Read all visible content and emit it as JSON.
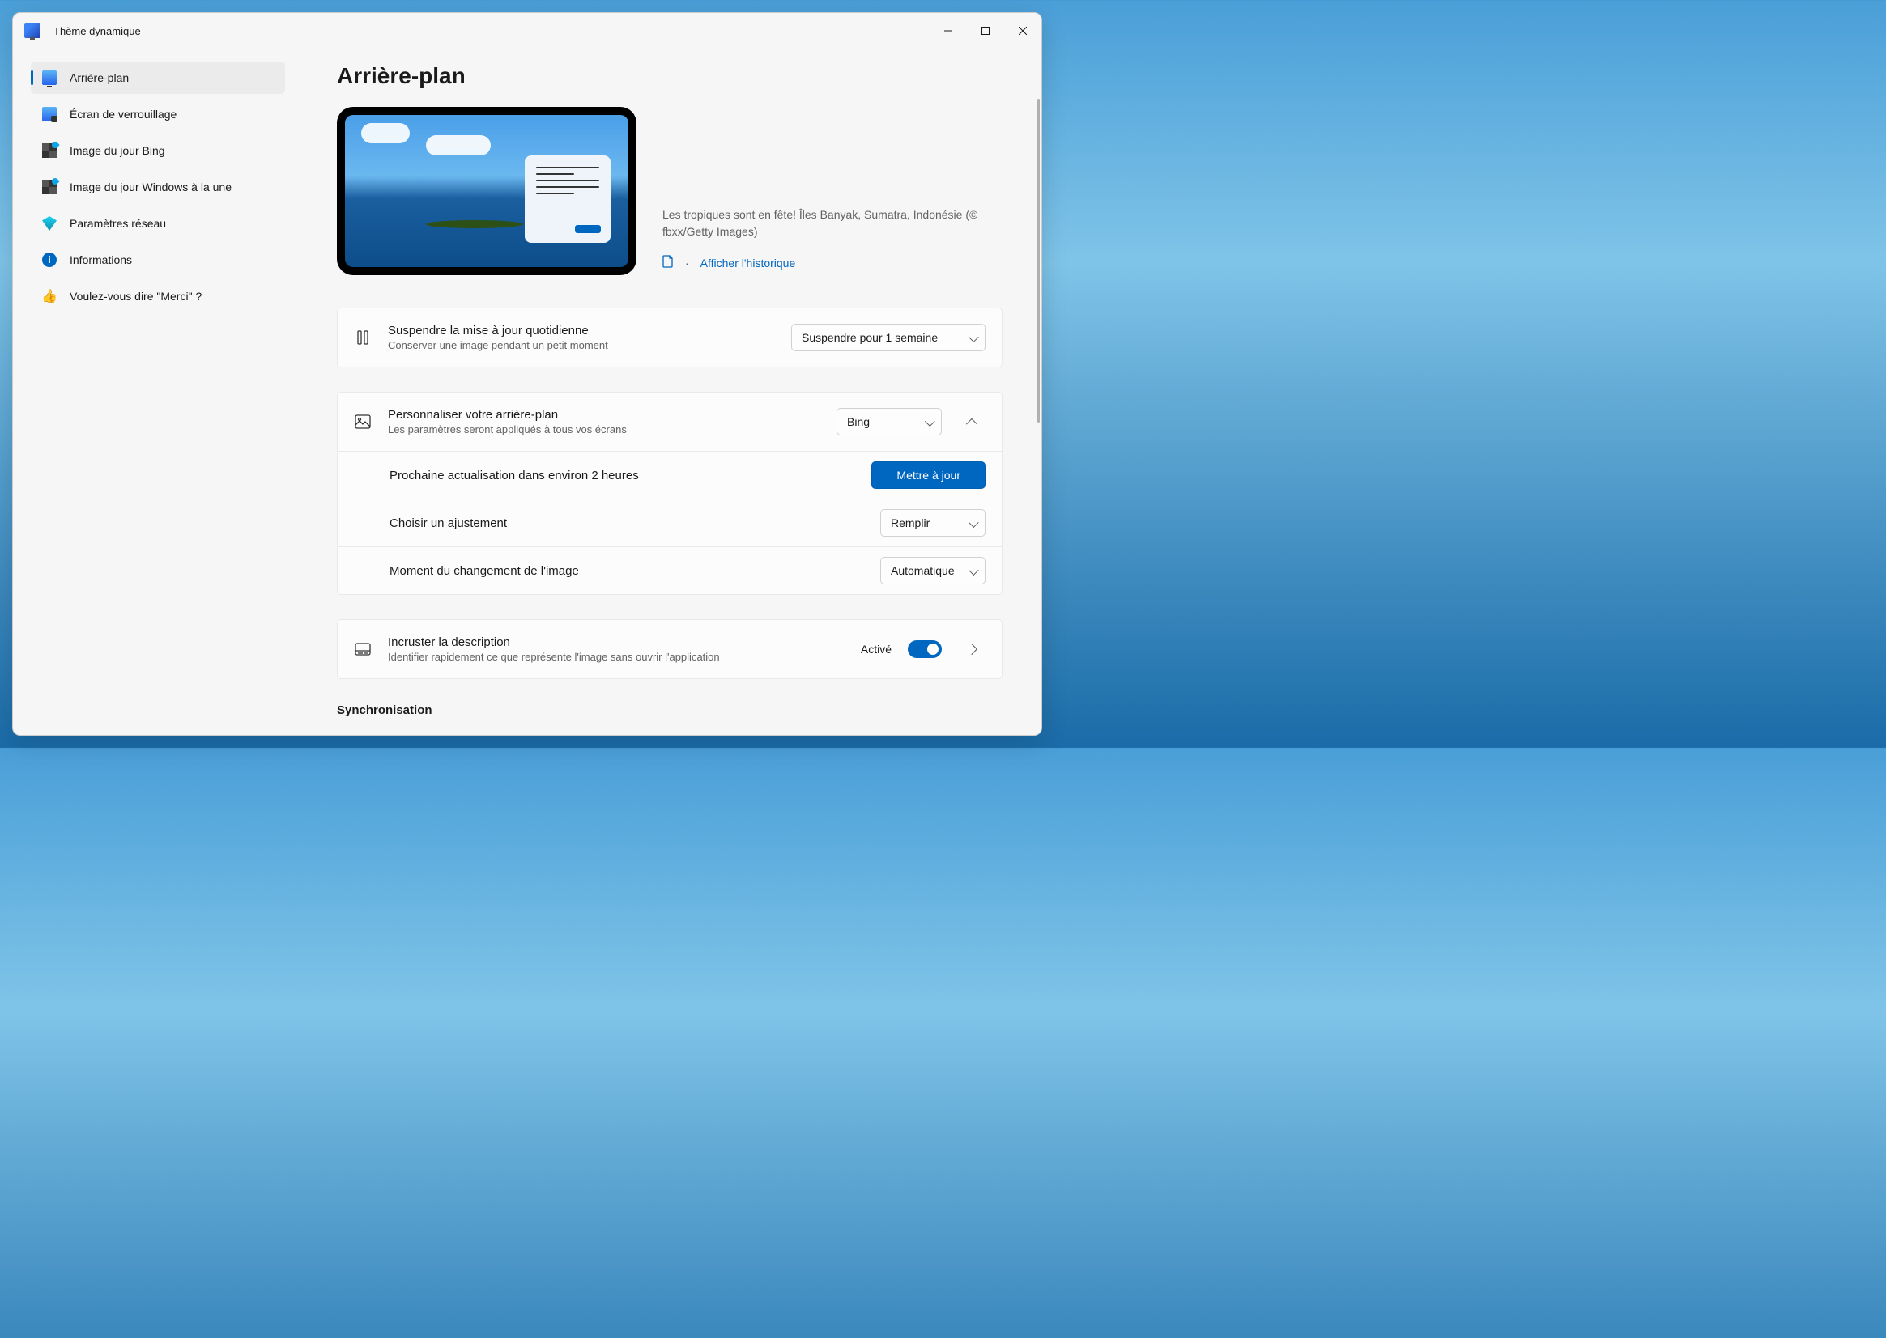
{
  "app": {
    "title": "Thème dynamique"
  },
  "sidebar": {
    "items": [
      {
        "label": "Arrière-plan",
        "active": true
      },
      {
        "label": "Écran de verrouillage"
      },
      {
        "label": "Image du jour Bing"
      },
      {
        "label": "Image du jour Windows à la une"
      },
      {
        "label": "Paramètres réseau"
      },
      {
        "label": "Informations"
      },
      {
        "label": "Voulez-vous dire \"Merci\" ?"
      }
    ]
  },
  "page": {
    "title": "Arrière-plan"
  },
  "preview": {
    "caption": "Les tropiques sont en fête! Îles Banyak, Sumatra, Indonésie (© fbxx/Getty Images)",
    "history_link": "Afficher l'historique",
    "separator": "·"
  },
  "cards": {
    "suspend": {
      "title": "Suspendre la mise à jour quotidienne",
      "subtitle": "Conserver une image pendant un petit moment",
      "dropdown": "Suspendre pour 1 semaine"
    },
    "personalize": {
      "title": "Personnaliser votre arrière-plan",
      "subtitle": "Les paramètres seront appliqués à tous vos écrans",
      "dropdown": "Bing",
      "refresh_text": "Prochaine actualisation dans environ 2 heures",
      "update_btn": "Mettre à jour",
      "fit_label": "Choisir un ajustement",
      "fit_value": "Remplir",
      "moment_label": "Moment du changement de l'image",
      "moment_value": "Automatique"
    },
    "embed": {
      "title": "Incruster la description",
      "subtitle": "Identifier rapidement ce que représente l'image sans ouvrir l'application",
      "state": "Activé"
    }
  },
  "sections": {
    "sync": "Synchronisation"
  }
}
